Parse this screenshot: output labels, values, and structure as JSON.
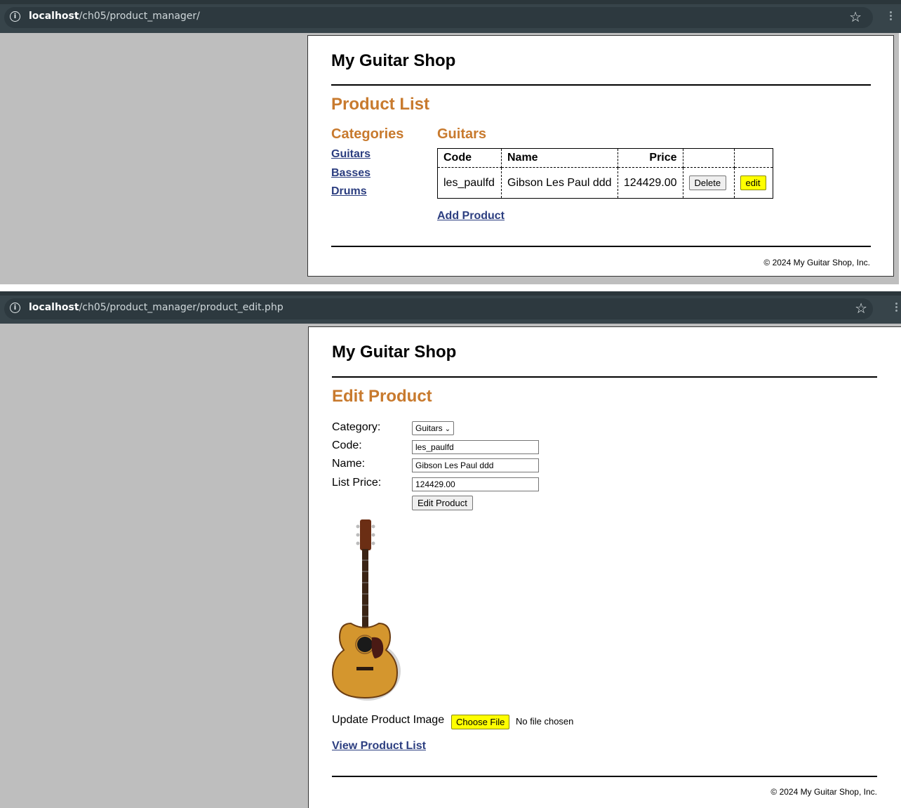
{
  "window1": {
    "url_host": "localhost",
    "url_path": "/ch05/product_manager/"
  },
  "window2": {
    "url_host": "localhost",
    "url_path": "/ch05/product_manager/product_edit.php"
  },
  "list_page": {
    "shop_name": "My Guitar Shop",
    "heading": "Product List",
    "categories_heading": "Categories",
    "categories": [
      "Guitars",
      "Basses",
      "Drums"
    ],
    "current_category": "Guitars",
    "table": {
      "headers": [
        "Code",
        "Name",
        "Price",
        "",
        ""
      ],
      "rows": [
        {
          "code": "les_paulfd",
          "name": "Gibson Les Paul ddd",
          "price": "124429.00",
          "delete_label": "Delete",
          "edit_label": "edit"
        }
      ]
    },
    "add_product_link": "Add Product",
    "footer": "© 2024 My Guitar Shop, Inc."
  },
  "edit_page": {
    "shop_name": "My Guitar Shop",
    "heading": "Edit Product",
    "labels": {
      "category": "Category:",
      "code": "Code:",
      "name": "Name:",
      "list_price": "List Price:"
    },
    "category_selected": "Guitars",
    "code_value": "les_paulfd",
    "name_value": "Gibson Les Paul ddd",
    "price_value": "124429.00",
    "submit_label": "Edit Product",
    "update_image_label": "Update Product Image",
    "choose_file_label": "Choose File",
    "no_file_text": "No file chosen",
    "view_list_link": "View Product List",
    "footer": "© 2024 My Guitar Shop, Inc."
  },
  "colors": {
    "accent_orange": "#c87a2e",
    "link_blue": "#2c3e80",
    "highlight_yellow": "#ffff00",
    "browser_bar": "#37444a"
  }
}
